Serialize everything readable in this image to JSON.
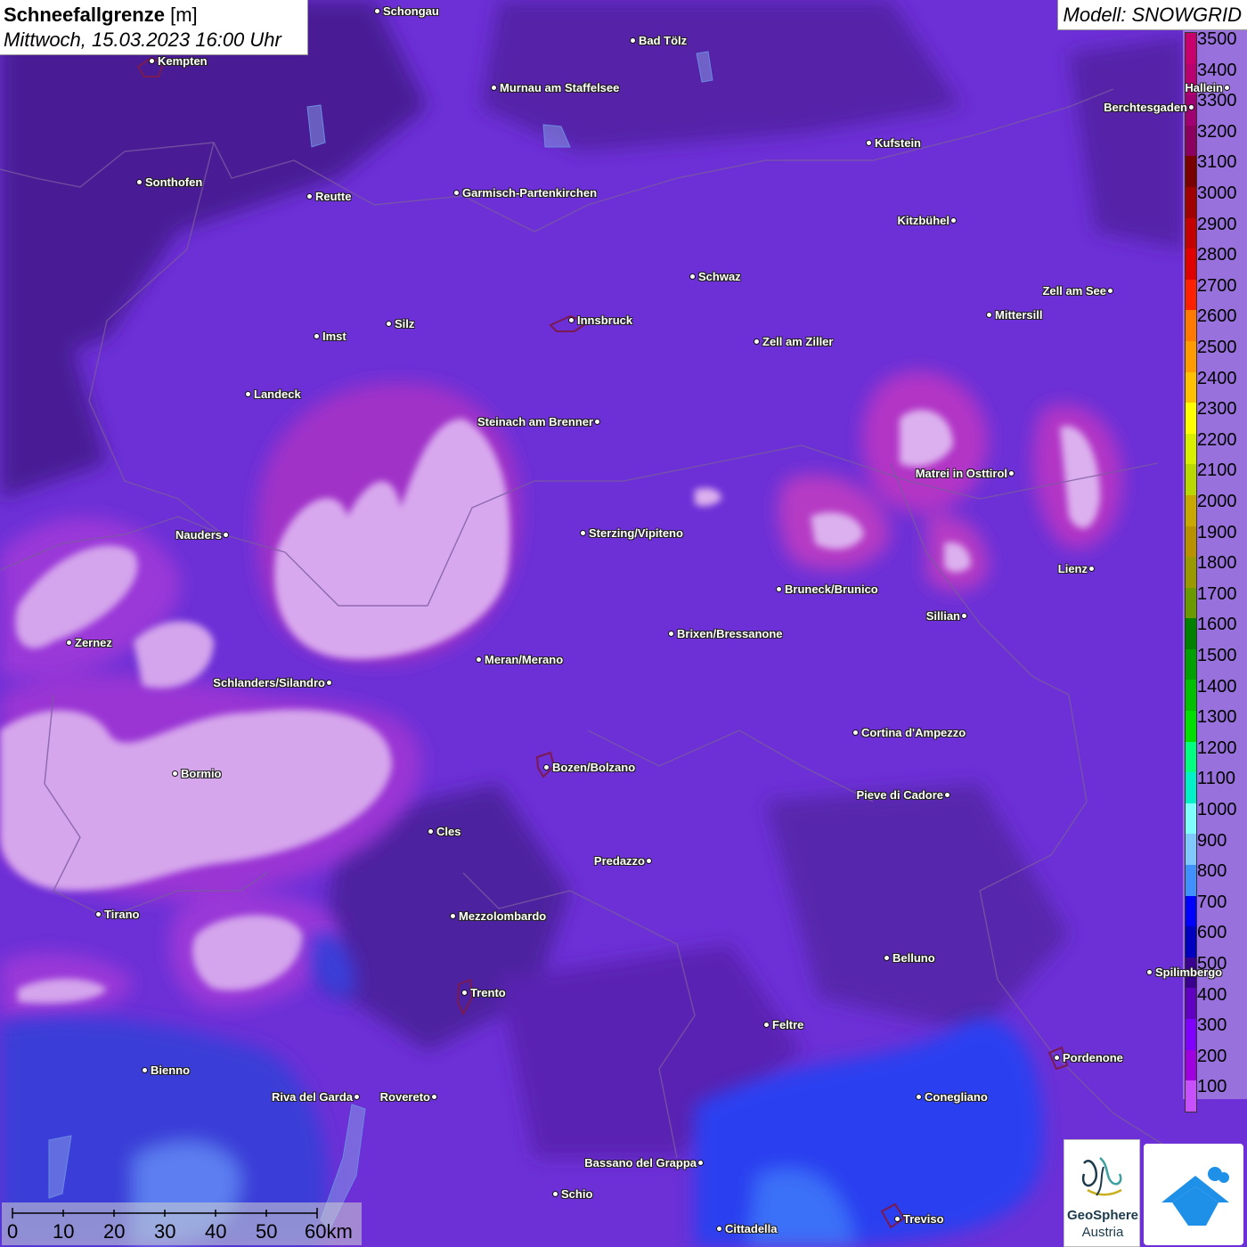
{
  "title": {
    "parameter": "Schneefallgrenze",
    "unit": "[m]",
    "datetime": "Mittwoch, 15.03.2023 16:00 Uhr"
  },
  "model": "Modell: SNOWGRID",
  "legend": {
    "labels": [
      "3500",
      "3400",
      "3300",
      "3200",
      "3100",
      "3000",
      "2900",
      "2800",
      "2700",
      "2600",
      "2500",
      "2400",
      "2300",
      "2200",
      "2100",
      "2000",
      "1900",
      "1800",
      "1700",
      "1600",
      "1500",
      "1400",
      "1300",
      "1200",
      "1100",
      "1000",
      "900",
      "800",
      "700",
      "600",
      "500",
      "400",
      "300",
      "200",
      "100"
    ],
    "colors": [
      "#c8006e",
      "#b80070",
      "#a00072",
      "#8c0060",
      "#7a0000",
      "#a00000",
      "#c40000",
      "#e00000",
      "#ff2000",
      "#ff7800",
      "#ff9a00",
      "#ffc000",
      "#ffff00",
      "#d8f000",
      "#b8d800",
      "#c8a800",
      "#b89000",
      "#9a9a00",
      "#6a9a00",
      "#008000",
      "#00a000",
      "#00c000",
      "#00e000",
      "#00ff80",
      "#00f0c8",
      "#80ffff",
      "#80c8ff",
      "#4090ff",
      "#0000ff",
      "#0000c0",
      "#3a0090",
      "#6000c0",
      "#8000ff",
      "#a000e0",
      "#c850ff"
    ]
  },
  "cities": [
    {
      "name": "Schongau",
      "label_side": "right"
    },
    {
      "name": "Bad Tölz",
      "label_side": "right"
    },
    {
      "name": "Kempten",
      "label_side": "right"
    },
    {
      "name": "Murnau am Staffelsee",
      "label_side": "right"
    },
    {
      "name": "Hallein",
      "label_side": "left"
    },
    {
      "name": "Berchtesgaden",
      "label_side": "left"
    },
    {
      "name": "Kufstein",
      "label_side": "right"
    },
    {
      "name": "Sonthofen",
      "label_side": "right"
    },
    {
      "name": "Reutte",
      "label_side": "right"
    },
    {
      "name": "Garmisch-Partenkirchen",
      "label_side": "right"
    },
    {
      "name": "Kitzbühel",
      "label_side": "left"
    },
    {
      "name": "Schwaz",
      "label_side": "right"
    },
    {
      "name": "Zell am See",
      "label_side": "left"
    },
    {
      "name": "Mittersill",
      "label_side": "right"
    },
    {
      "name": "Innsbruck",
      "label_side": "right"
    },
    {
      "name": "Silz",
      "label_side": "right"
    },
    {
      "name": "Imst",
      "label_side": "right"
    },
    {
      "name": "Zell am Ziller",
      "label_side": "right"
    },
    {
      "name": "Landeck",
      "label_side": "right"
    },
    {
      "name": "Steinach am Brenner",
      "label_side": "left"
    },
    {
      "name": "Matrei in Osttirol",
      "label_side": "left"
    },
    {
      "name": "Nauders",
      "label_side": "left"
    },
    {
      "name": "Sterzing/Vipiteno",
      "label_side": "right"
    },
    {
      "name": "Lienz",
      "label_side": "left"
    },
    {
      "name": "Bruneck/Brunico",
      "label_side": "right"
    },
    {
      "name": "Sillian",
      "label_side": "left"
    },
    {
      "name": "Brixen/Bressanone",
      "label_side": "right"
    },
    {
      "name": "Zernez",
      "label_side": "right"
    },
    {
      "name": "Meran/Merano",
      "label_side": "right"
    },
    {
      "name": "Schlanders/Silandro",
      "label_side": "left"
    },
    {
      "name": "Cortina d'Ampezzo",
      "label_side": "right"
    },
    {
      "name": "Bozen/Bolzano",
      "label_side": "right"
    },
    {
      "name": "Bormio",
      "label_side": "right"
    },
    {
      "name": "Pieve di Cadore",
      "label_side": "left"
    },
    {
      "name": "Cles",
      "label_side": "right"
    },
    {
      "name": "Predazzo",
      "label_side": "left"
    },
    {
      "name": "Tirano",
      "label_side": "right"
    },
    {
      "name": "Mezzolombardo",
      "label_side": "right"
    },
    {
      "name": "Belluno",
      "label_side": "right"
    },
    {
      "name": "Spilimbergo",
      "label_side": "right"
    },
    {
      "name": "Trento",
      "label_side": "right"
    },
    {
      "name": "Feltre",
      "label_side": "right"
    },
    {
      "name": "Pordenone",
      "label_side": "right"
    },
    {
      "name": "Bienno",
      "label_side": "right"
    },
    {
      "name": "Riva del Garda",
      "label_side": "left"
    },
    {
      "name": "Rovereto",
      "label_side": "left"
    },
    {
      "name": "Conegliano",
      "label_side": "right"
    },
    {
      "name": "Bassano del Grappa",
      "label_side": "left"
    },
    {
      "name": "Schio",
      "label_side": "right"
    },
    {
      "name": "Treviso",
      "label_side": "right"
    },
    {
      "name": "Cittadella",
      "label_side": "right"
    }
  ],
  "scalebar": {
    "labels": [
      "0",
      "10",
      "20",
      "30",
      "40",
      "50",
      "60km"
    ]
  },
  "logos": {
    "geosphere_line1": "GeoSphere",
    "geosphere_line2": "Austria"
  }
}
